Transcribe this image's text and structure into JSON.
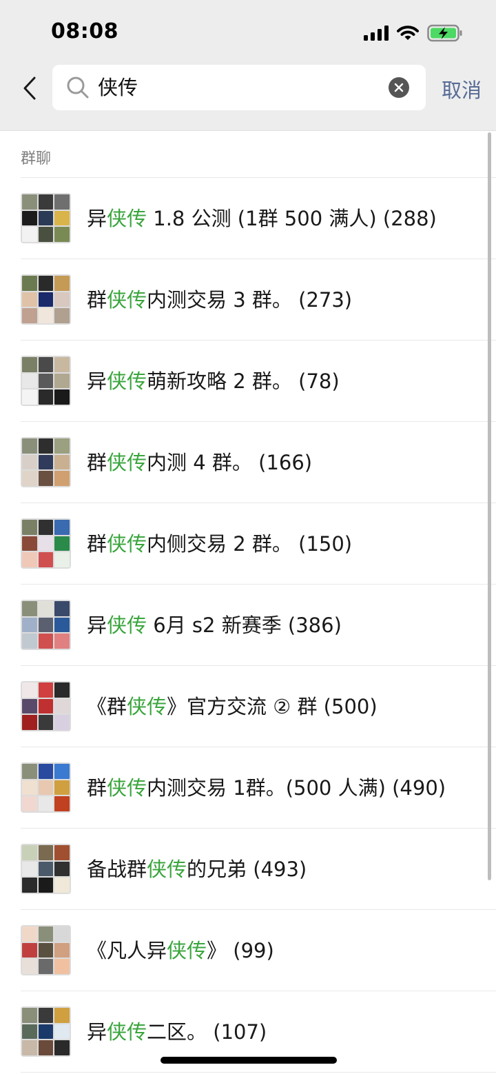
{
  "status_bar": {
    "time": "08:08"
  },
  "search": {
    "query": "侠传",
    "cancel_label": "取消"
  },
  "section_label": "群聊",
  "highlight_color": "#3aa53d",
  "groups": [
    {
      "before": "异",
      "match": "侠传",
      "after": " 1.8 公测 (1群 500 满人) (288)",
      "colors": [
        "#8a8f7a",
        "#3a3a3a",
        "#6f6f6f",
        "#1c1c1c",
        "#2b3a55",
        "#d9b44a",
        "#f2f2f2",
        "#4a5040",
        "#7a8a55"
      ]
    },
    {
      "before": "群",
      "match": "侠传",
      "after": "内测交易 3 群。 (273)",
      "colors": [
        "#6b7a50",
        "#2a2a2a",
        "#c49a55",
        "#e0c2a8",
        "#1a2a6a",
        "#d8c8c0",
        "#c0a090",
        "#f0e6dc",
        "#b0a090"
      ]
    },
    {
      "before": "异",
      "match": "侠传",
      "after": "萌新攻略 2 群。 (78)",
      "colors": [
        "#7a8065",
        "#4a4a4a",
        "#c8b8a0",
        "#e8e8e8",
        "#5a5a5a",
        "#b0a890",
        "#f4f4f4",
        "#2a2a2a",
        "#1a1a1a"
      ]
    },
    {
      "before": "群",
      "match": "侠传",
      "after": "内测 4 群。 (166)",
      "colors": [
        "#8a8f7a",
        "#2e2e2e",
        "#9aa080",
        "#d8d0c8",
        "#303a5a",
        "#c8b090",
        "#e0d4c8",
        "#6a5040",
        "#d0a070"
      ]
    },
    {
      "before": "群",
      "match": "侠传",
      "after": "内侧交易 2 群。 (150)",
      "colors": [
        "#7a8065",
        "#303030",
        "#3a6ab0",
        "#8a4a3a",
        "#e8e0e8",
        "#2a8a4a",
        "#f0c8b8",
        "#d05050",
        "#e8f0e8"
      ]
    },
    {
      "before": "异",
      "match": "侠传",
      "after": " 6月 s2 新赛季 (386)",
      "colors": [
        "#8a8f7a",
        "#e0e0d8",
        "#3a4a6a",
        "#a0b0c8",
        "#5a6070",
        "#2a5a9a",
        "#c0c8d0",
        "#d05050",
        "#e08080"
      ]
    },
    {
      "before": "《群",
      "match": "侠传",
      "after": "》官方交流 ② 群 (500)",
      "colors": [
        "#f0e8e8",
        "#d04040",
        "#2a2a2a",
        "#5a4a6a",
        "#c03030",
        "#e0d8d8",
        "#a02020",
        "#3a3a3a",
        "#d8d0e0"
      ]
    },
    {
      "before": "群",
      "match": "侠传",
      "after": "内测交易 1群。(500 人满) (490)",
      "colors": [
        "#8a8f7a",
        "#2a4aa0",
        "#3a7ad0",
        "#f0e0d0",
        "#e8c8b0",
        "#d0a040",
        "#f0d8d0",
        "#e8e8e8",
        "#c04020"
      ]
    },
    {
      "before": "备战群",
      "match": "侠传",
      "after": "的兄弟 (493)",
      "colors": [
        "#c8d0b8",
        "#7a6a50",
        "#a05030",
        "#e8e8e8",
        "#4a5a6a",
        "#303030",
        "#2a2a2a",
        "#1a1a1a",
        "#f0e8d8"
      ]
    },
    {
      "before": "《凡人异",
      "match": "侠传",
      "after": "》 (99)",
      "colors": [
        "#f0d8c8",
        "#8a8f7a",
        "#d8d8d8",
        "#c04040",
        "#5a5040",
        "#d0a080",
        "#e8e0d8",
        "#6a6a6a",
        "#f0c0a0"
      ]
    },
    {
      "before": "异",
      "match": "侠传",
      "after": "二区。 (107)",
      "colors": [
        "#8a8f7a",
        "#3a3a3a",
        "#d0a040",
        "#5a6a5a",
        "#1a3a6a",
        "#e0e8f0",
        "#c8b8a8",
        "#6a4a3a",
        "#2a2a2a"
      ]
    }
  ]
}
